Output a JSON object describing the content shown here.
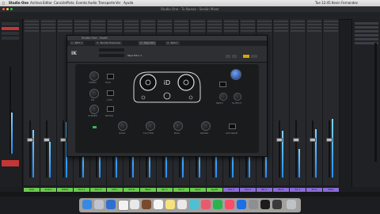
{
  "menubar": {
    "app_name": "Studio One",
    "items": [
      "Archivo",
      "Editar",
      "Canción",
      "Pista",
      "Evento",
      "Audio",
      "Transporte",
      "Ver",
      "Ayuda"
    ],
    "status_right": "Tue 12:45   Kevin Fernandez"
  },
  "window": {
    "title": "Studio One - Tu Nueva - Sesión Mixer"
  },
  "plugin": {
    "title": "Studio One - Insert",
    "tabs": [
      "1 - BDT 1",
      "2 - Bombo Presonus",
      "3 - Tape Sim",
      "4 - BAS 1"
    ],
    "brand": "IK",
    "preset": "Tape Echo 1",
    "controls": {
      "left_labels": [
        "SPEED",
        "HISS",
        "EQ",
        "LOW",
        "STEREO",
        "RETRO"
      ],
      "bottom_labels": [
        "WOW",
        "FLUTTER",
        "BIAS",
        "REPRO",
        "SATURATE"
      ],
      "right_labels": [
        "INPUT",
        "OUTPUT"
      ]
    }
  },
  "mixer": {
    "channels": [
      {
        "name": "Kick"
      },
      {
        "name": "Snare"
      },
      {
        "name": "HiHat"
      },
      {
        "name": "Tom 1"
      },
      {
        "name": "Tom 2"
      },
      {
        "name": "OH L"
      },
      {
        "name": "OH R"
      },
      {
        "name": "Bass"
      },
      {
        "name": "Gtr 1"
      },
      {
        "name": "Gtr 2"
      },
      {
        "name": "Keys"
      },
      {
        "name": "Synth"
      },
      {
        "name": "Vox 1"
      },
      {
        "name": "Vox 2"
      },
      {
        "name": "BV 1"
      },
      {
        "name": "BV 2"
      },
      {
        "name": "FX 1"
      },
      {
        "name": "FX 2"
      },
      {
        "name": "Main"
      }
    ]
  },
  "colors": {
    "accent": "#1f8cff",
    "meter_top": "#7fd3ff",
    "dock_bg": "#d2cdc8",
    "label_green": "#6bc94f",
    "label_purple": "#8a6cd6"
  }
}
